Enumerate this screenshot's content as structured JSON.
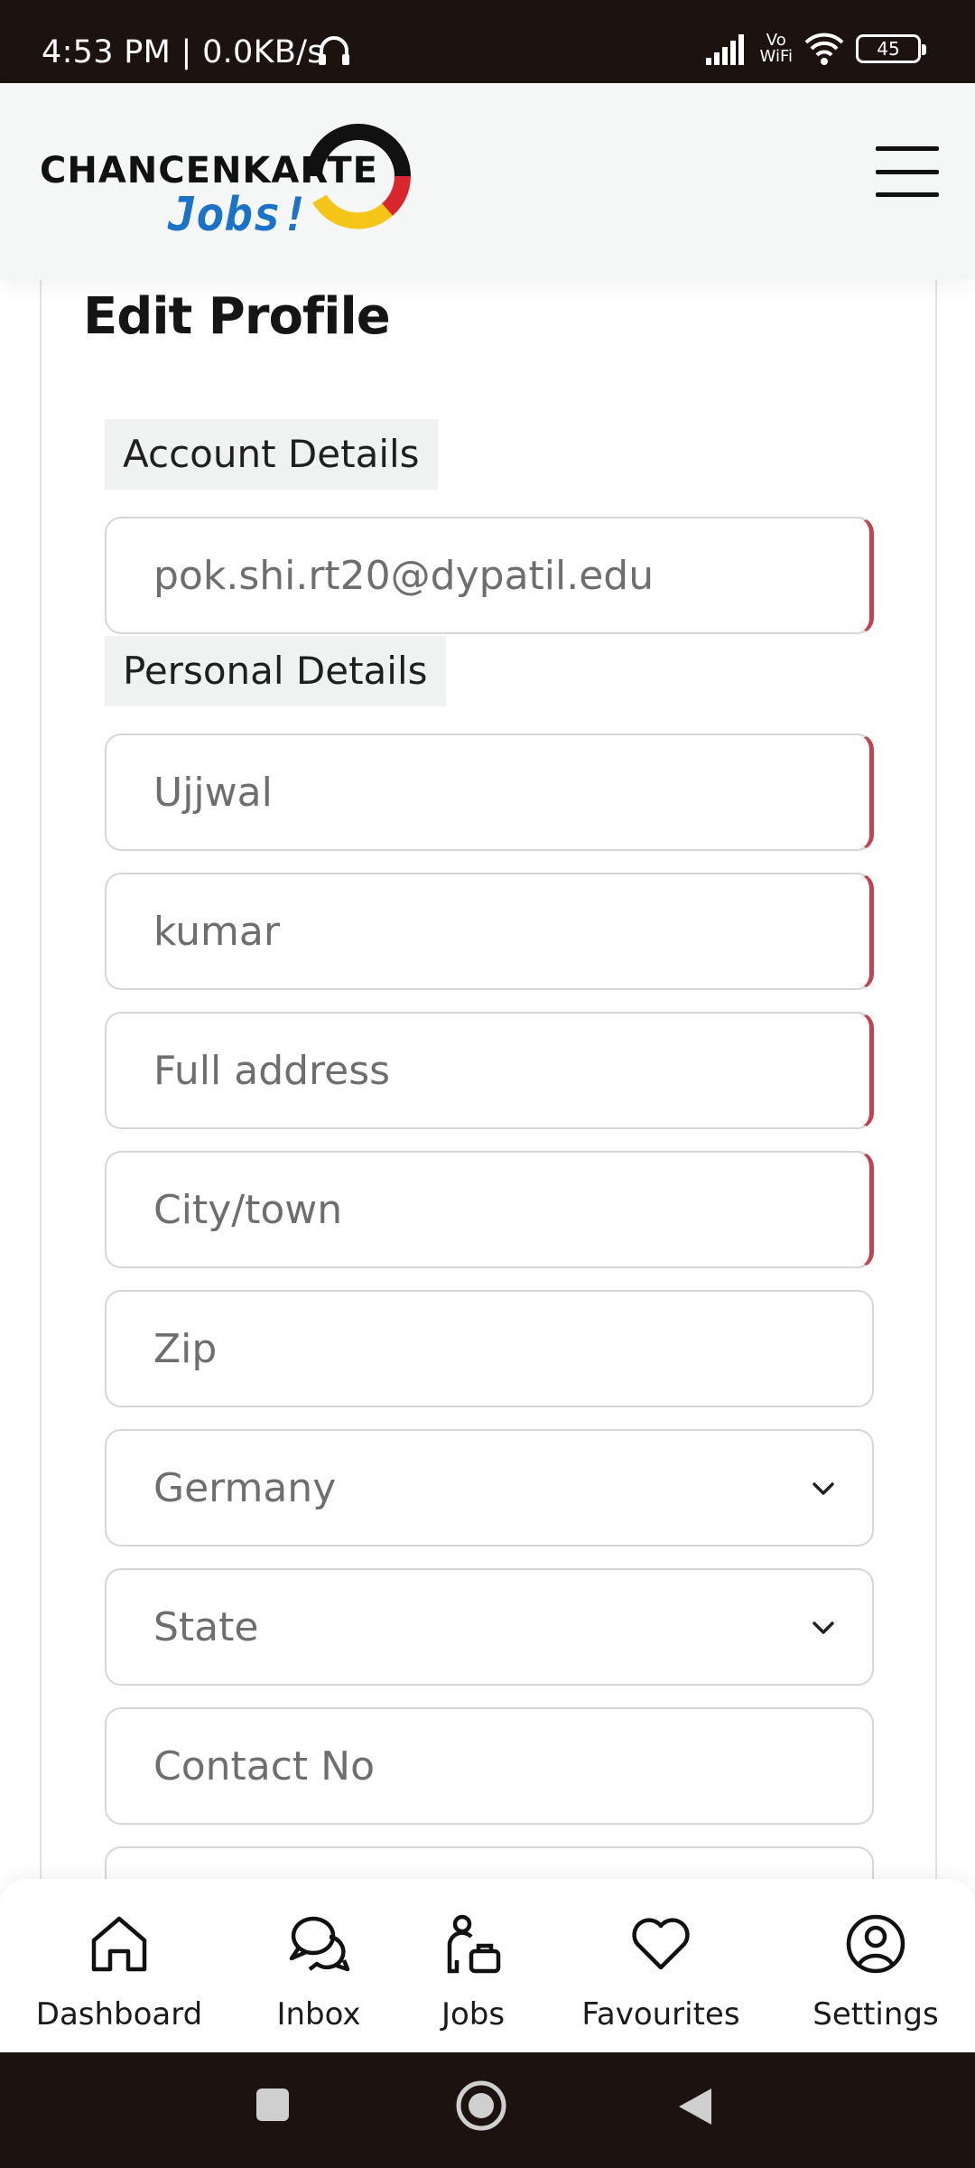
{
  "status_bar": {
    "time": "4:53 PM | 0.0KB/s",
    "network": "Vo\nWiFi",
    "battery": "45"
  },
  "header": {
    "logo_title": "CHANCENKARTE",
    "logo_subtitle": "Jobs!"
  },
  "page": {
    "title": "Edit Profile"
  },
  "sections": {
    "account": "Account Details",
    "personal": "Personal Details"
  },
  "fields": {
    "email": {
      "value": "pok.shi.rt20@dypatil.edu"
    },
    "first_name": {
      "value": "Ujjwal"
    },
    "last_name": {
      "value": "kumar"
    },
    "address": {
      "placeholder": "Full address"
    },
    "city": {
      "placeholder": "City/town"
    },
    "zip": {
      "placeholder": "Zip"
    },
    "country": {
      "selected": "Germany"
    },
    "state": {
      "selected": "State"
    },
    "contact": {
      "placeholder": "Contact No"
    }
  },
  "bottom_nav": {
    "items": [
      {
        "label": "Dashboard",
        "icon": "home-icon"
      },
      {
        "label": "Inbox",
        "icon": "chat-icon"
      },
      {
        "label": "Jobs",
        "icon": "jobs-icon"
      },
      {
        "label": "Favourites",
        "icon": "heart-icon"
      },
      {
        "label": "Settings",
        "icon": "account-icon"
      }
    ]
  },
  "colors": {
    "invalid_border": "#c8404a",
    "logo_blue": "#1a73c9",
    "flag_black": "#111111",
    "flag_red": "#d9262c",
    "flag_gold": "#f5c518"
  }
}
